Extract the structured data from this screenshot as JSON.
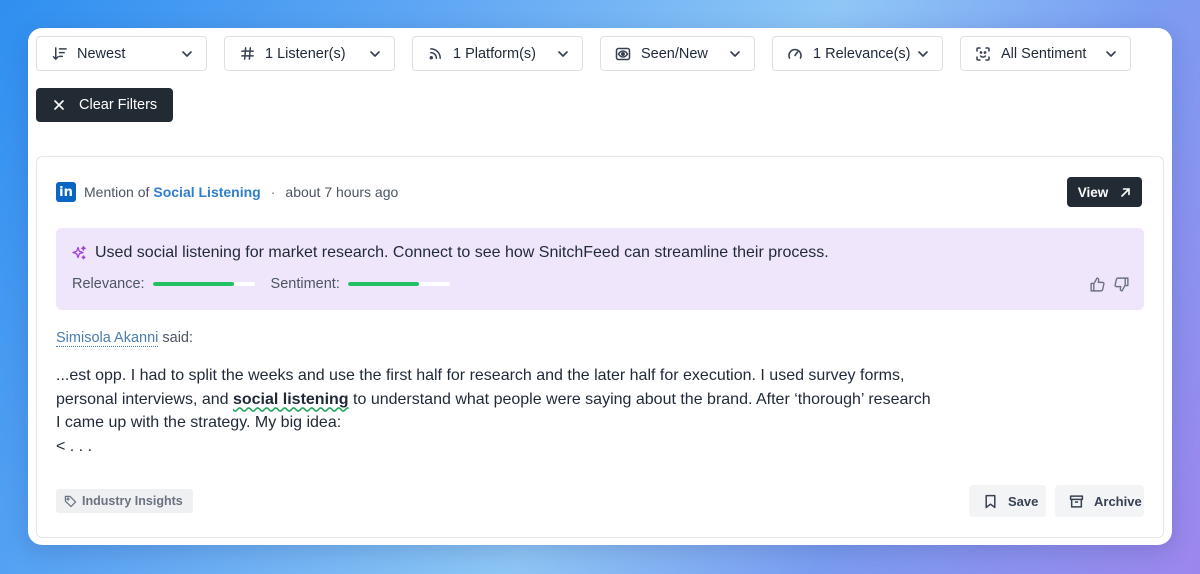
{
  "filters": [
    {
      "label": "Newest",
      "icon": "sort-icon"
    },
    {
      "label": "1 Listener(s)",
      "icon": "hash-icon"
    },
    {
      "label": "1 Platform(s)",
      "icon": "rss-icon"
    },
    {
      "label": "Seen/New",
      "icon": "eye-icon"
    },
    {
      "label": "1 Relevance(s)",
      "icon": "gauge-icon"
    },
    {
      "label": "All Sentiment",
      "icon": "face-scan-icon"
    }
  ],
  "clear_filters": "Clear Filters",
  "card": {
    "platform_icon": "linkedin-icon",
    "mention_prefix": "Mention of",
    "mention_term": "Social Listening",
    "separator": "·",
    "time_ago": "about 7 hours ago",
    "view_label": "View",
    "insight": "Used social listening for market research. Connect to see how SnitchFeed can streamline their process.",
    "relevance_label": "Relevance:",
    "relevance_value": 0.8,
    "sentiment_label": "Sentiment:",
    "sentiment_value": 0.7,
    "author": "Simisola Akanni",
    "author_suffix": "said:",
    "text_before": "...est opp. I had to split the weeks and use the first half for research and the later half for execution. I used survey forms, personal interviews, and ",
    "keyword": "social listening",
    "text_after": " to understand what people were saying about the brand. After ‘thorough’ research I came up with the strategy. My big idea:",
    "text_tail": "< . . .",
    "tag": "Industry Insights",
    "save_label": "Save",
    "archive_label": "Archive"
  },
  "colors": {
    "accent_dark": "#222b33",
    "link": "#2f7ec9",
    "insight_bg": "#f0e6fb",
    "bar_green": "#22c063",
    "linkedin": "#0a66c2"
  }
}
